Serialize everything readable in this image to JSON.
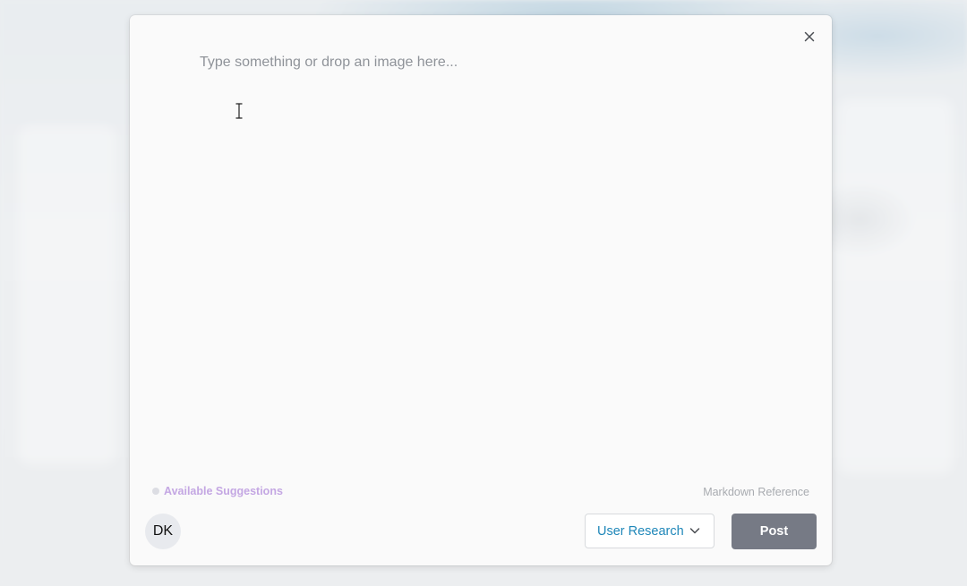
{
  "composer": {
    "placeholder": "Type something or drop an image here...",
    "value": "",
    "suggestions_label": "Available Suggestions",
    "markdown_label": "Markdown Reference",
    "avatar_initials": "DK",
    "team_selected": "User Research",
    "post_label": "Post"
  },
  "icons": {
    "close": "close-icon",
    "chevron": "chevron-down-icon",
    "cursor": "text-cursor-icon"
  },
  "colors": {
    "suggestions_text": "#c4a7e3",
    "team_text": "#1f87b9",
    "post_button_bg": "#767a85"
  }
}
